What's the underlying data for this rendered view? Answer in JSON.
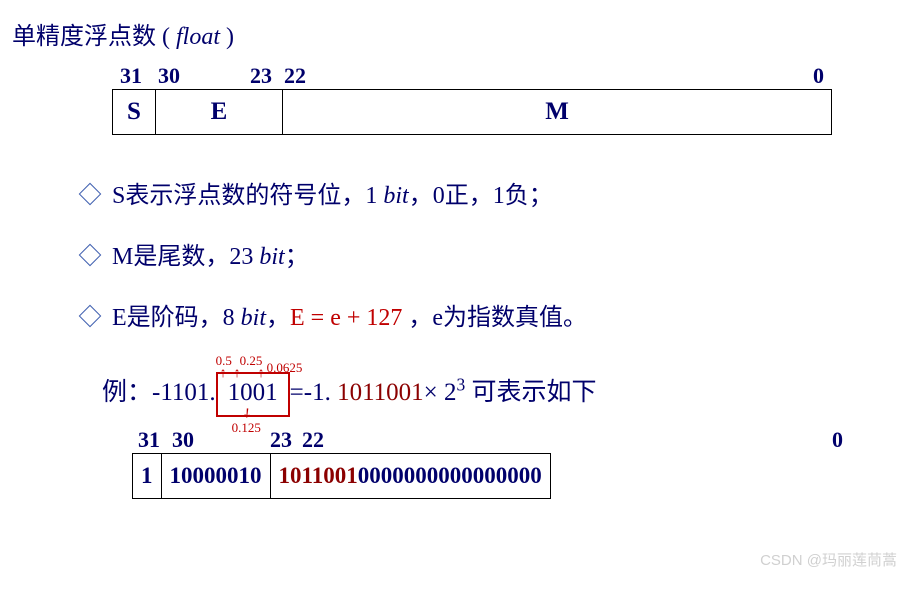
{
  "title_cn": "单精度浮点数 ( ",
  "title_float": "float",
  "title_end": " )",
  "layout1": {
    "p31": "31",
    "p30": "30",
    "p23": "23",
    "p22": "22",
    "p0": "0",
    "S": "S",
    "E": "E",
    "M": "M"
  },
  "bullet_s": "S表示浮点数的符号位，1 ",
  "bullet_s_bit": "bit",
  "bullet_s_tail": "，0正，1负；",
  "bullet_m": "M是尾数，23 ",
  "bullet_m_bit": "bit",
  "bullet_m_tail": "；",
  "bullet_e_pre": "E是阶码，8 ",
  "bullet_e_bit": "bit",
  "bullet_e_sep": "，",
  "bullet_e_formula": "E  =  e  +  127 ",
  "bullet_e_tail": "，e为指数真值。",
  "example": {
    "prefix": "例：-1101.",
    "boxed": "1001",
    "after_box": "=-1. ",
    "red_bits": "1011001",
    "times": "× 2",
    "exp": "3",
    "tail": " 可表示如下",
    "anno05": "0.5",
    "anno025": "0.25",
    "anno00625": "0.0625",
    "anno0125": "0.125"
  },
  "row": {
    "p31": "31",
    "p30": "30",
    "p23": "23",
    "p22": "22",
    "p0": "0",
    "sign": "1",
    "exp": "10000010",
    "frac_red": "1011001",
    "frac_rest": "0000000000000000"
  },
  "watermark": "CSDN @玛丽莲茼蒿"
}
